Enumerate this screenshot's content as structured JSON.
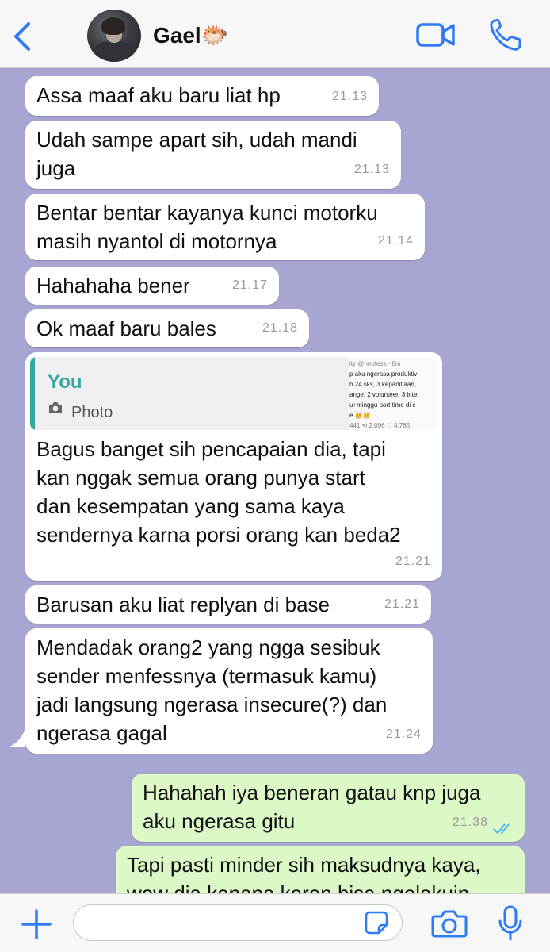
{
  "header": {
    "contact_name": "Gael",
    "contact_emoji": "🐡",
    "icons": {
      "back": "chevron-left-icon",
      "video": "video-camera-icon",
      "call": "phone-icon"
    }
  },
  "messages": [
    {
      "direction": "in",
      "lines": [
        "Assa maaf aku baru liat hp"
      ],
      "time": "21.13"
    },
    {
      "direction": "in",
      "lines": [
        "Udah sampe apart sih, udah mandi",
        "juga"
      ],
      "time": "21.13"
    },
    {
      "direction": "in",
      "lines": [
        "Bentar bentar kayanya kunci motorku",
        "masih nyantol di motornya"
      ],
      "time": "21.14"
    },
    {
      "direction": "in",
      "lines": [
        "Hahahaha bener"
      ],
      "time": "21.17"
    },
    {
      "direction": "in",
      "lines": [
        "Ok maaf baru bales"
      ],
      "time": "21.18"
    },
    {
      "direction": "in",
      "quote": {
        "author": "You",
        "type": "Photo",
        "thumbnail_lines": [
          "ity @neofess · 8m",
          "p aku ngerasa produktiv",
          "h 24 sks, 3 kepanitiaan,",
          "ange, 2 volunteer, 3 inte",
          "u+minggu part time di c",
          "e.🥳🥳",
          "441   ⟲ 2.096   ♡ 4.785"
        ]
      },
      "lines": [
        "Bagus banget sih pencapaian dia, tapi",
        "kan nggak semua orang punya start",
        "dan kesempatan yang sama kaya",
        "sendernya karna porsi orang kan beda2"
      ],
      "time": "21.21"
    },
    {
      "direction": "in",
      "lines": [
        "Barusan aku liat replyan di base"
      ],
      "time": "21.21"
    },
    {
      "direction": "in",
      "lines": [
        "Mendadak orang2 yang ngga sesibuk",
        "sender menfessnya (termasuk kamu)",
        "jadi langsung ngerasa insecure(?) dan",
        "ngerasa gagal"
      ],
      "time": "21.24"
    },
    {
      "direction": "out",
      "lines": [
        "Hahahah iya beneran gatau knp juga",
        "aku ngerasa gitu"
      ],
      "time": "21.38",
      "status": "read"
    },
    {
      "direction": "out",
      "lines": [
        "Tapi pasti minder sih maksudnya kaya,",
        "wow dia kenapa keren bisa ngelakuin"
      ]
    }
  ],
  "composer": {
    "placeholder": "",
    "icons": {
      "attach": "plus-icon",
      "sticker": "sticker-icon",
      "camera": "camera-icon",
      "mic": "microphone-icon"
    }
  },
  "colors": {
    "accent": "#2f7bf5",
    "chat_background": "#a7a5d1",
    "incoming_bubble": "#ffffff",
    "outgoing_bubble": "#dcf8c6",
    "quote_bar": "#35a79f",
    "read_ticks": "#4fb6ec"
  }
}
